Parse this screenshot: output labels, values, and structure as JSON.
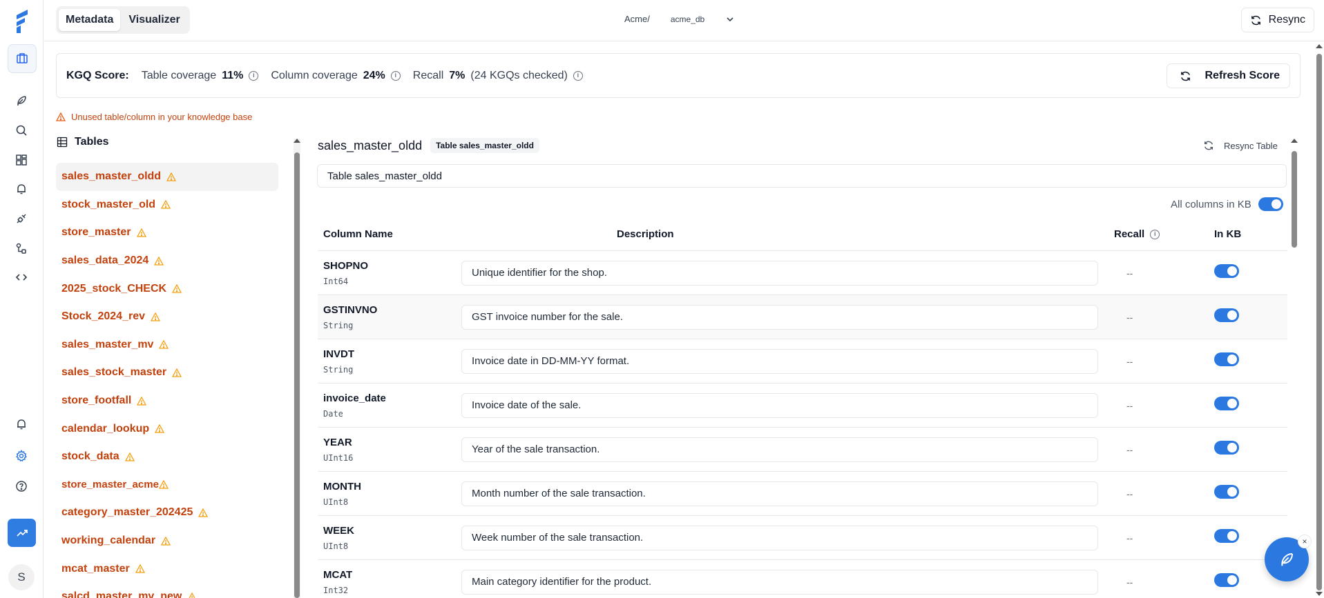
{
  "nav": {
    "segments": [
      {
        "label": "Metadata",
        "active": true
      },
      {
        "label": "Visualizer",
        "active": false
      }
    ],
    "breadcrumb_org": "Acme/",
    "breadcrumb_db": "acme_db",
    "resync_label": "Resync"
  },
  "rail": {
    "items": [
      "layers-icon",
      "feather-icon",
      "search-icon",
      "dashboard-icon",
      "bell-icon",
      "plug-icon",
      "workflow-icon",
      "code-icon"
    ],
    "bottom": [
      "bell-icon",
      "gear-icon",
      "help-icon",
      "trend-icon"
    ],
    "avatar": "S"
  },
  "kgq": {
    "label": "KGQ Score:",
    "table_coverage_label": "Table coverage",
    "table_coverage_value": "11%",
    "column_coverage_label": "Column coverage",
    "column_coverage_value": "24%",
    "recall_label": "Recall",
    "recall_value": "7%",
    "recall_note": "(24 KGQs checked)",
    "refresh_label": "Refresh Score"
  },
  "warning": "Unused table/column in your knowledge base",
  "tables": {
    "heading": "Tables",
    "items": [
      {
        "name": "sales_master_oldd",
        "active": true
      },
      {
        "name": "stock_master_old"
      },
      {
        "name": "store_master"
      },
      {
        "name": "sales_data_2024"
      },
      {
        "name": "2025_stock_CHECK"
      },
      {
        "name": "Stock_2024_rev"
      },
      {
        "name": "sales_master_mv"
      },
      {
        "name": "sales_stock_master"
      },
      {
        "name": "store_footfall"
      },
      {
        "name": "calendar_lookup"
      },
      {
        "name": "stock_data"
      },
      {
        "name": "store_master_acme",
        "tight": true
      },
      {
        "name": "category_master_202425"
      },
      {
        "name": "working_calendar"
      },
      {
        "name": "mcat_master"
      },
      {
        "name": "salcd_master_mv_new"
      }
    ]
  },
  "detail": {
    "table_name": "sales_master_oldd",
    "chip": "Table sales_master_oldd",
    "resync_table_label": "Resync Table",
    "description_value": "Table sales_master_oldd",
    "all_columns_label": "All columns in KB",
    "headers": {
      "name": "Column Name",
      "description": "Description",
      "recall": "Recall",
      "in_kb": "In KB"
    },
    "columns": [
      {
        "name": "SHOPNO",
        "type": "Int64",
        "description": "Unique identifier for the shop.",
        "recall": "--",
        "in_kb": true
      },
      {
        "name": "GSTINVNO",
        "type": "String",
        "description": "GST invoice number for the sale.",
        "recall": "--",
        "in_kb": true
      },
      {
        "name": "INVDT",
        "type": "String",
        "description": "Invoice date in DD-MM-YY format.",
        "recall": "--",
        "in_kb": true
      },
      {
        "name": "invoice_date",
        "type": "Date",
        "description": "Invoice date of the sale.",
        "recall": "--",
        "in_kb": true
      },
      {
        "name": "YEAR",
        "type": "UInt16",
        "description": "Year of the sale transaction.",
        "recall": "--",
        "in_kb": true
      },
      {
        "name": "MONTH",
        "type": "UInt8",
        "description": "Month number of the sale transaction.",
        "recall": "--",
        "in_kb": true
      },
      {
        "name": "WEEK",
        "type": "UInt8",
        "description": "Week number of the sale transaction.",
        "recall": "--",
        "in_kb": true
      },
      {
        "name": "MCAT",
        "type": "Int32",
        "description": "Main category identifier for the product.",
        "recall": "--",
        "in_kb": true
      }
    ]
  },
  "fab_close": "×"
}
